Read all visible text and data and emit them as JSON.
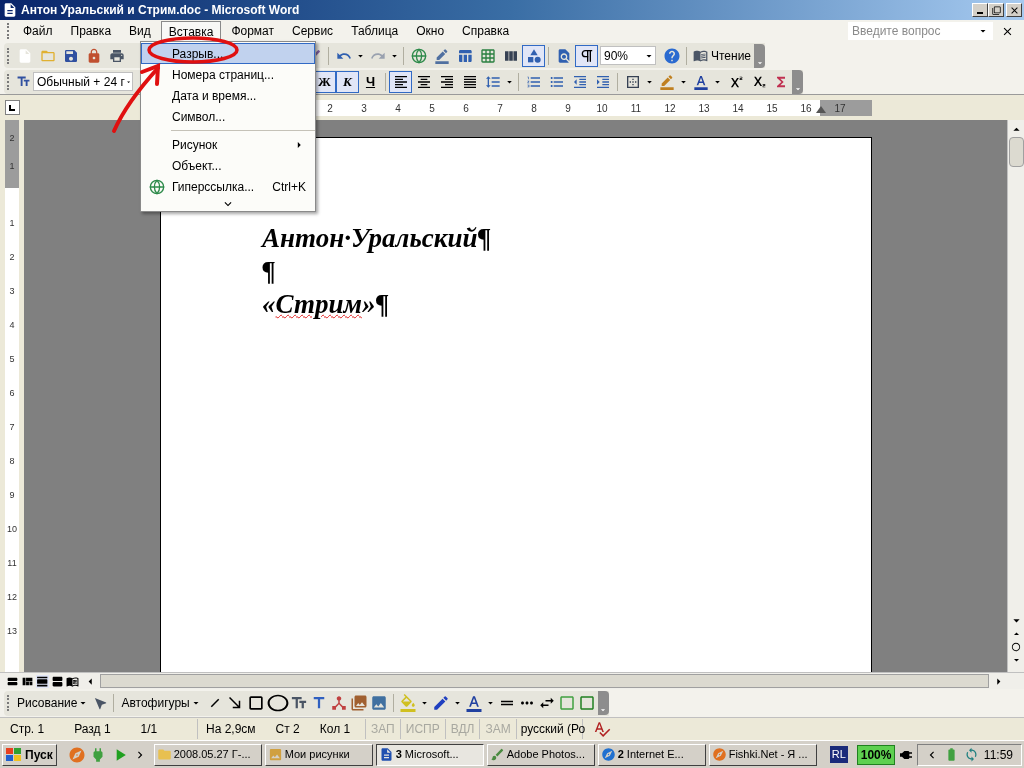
{
  "window": {
    "title": "Антон Уральский и Стрим.doc - Microsoft Word"
  },
  "menu_bar": {
    "items": [
      {
        "label": "Файл",
        "selected": false
      },
      {
        "label": "Правка",
        "selected": false
      },
      {
        "label": "Вид",
        "selected": false
      },
      {
        "label": "Вставка",
        "selected": true
      },
      {
        "label": "Формат",
        "selected": false
      },
      {
        "label": "Сервис",
        "selected": false
      },
      {
        "label": "Таблица",
        "selected": false
      },
      {
        "label": "Окно",
        "selected": false
      },
      {
        "label": "Справка",
        "selected": false
      }
    ],
    "help_placeholder": "Введите вопрос"
  },
  "insert_menu": {
    "items": [
      {
        "kind": "item",
        "label": "Разрыв...",
        "selected": true
      },
      {
        "kind": "item",
        "label": "Номера страниц...",
        "selected": false
      },
      {
        "kind": "item",
        "label": "Дата и время...",
        "selected": false
      },
      {
        "kind": "item",
        "label": "Символ...",
        "selected": false
      },
      {
        "kind": "separator"
      },
      {
        "kind": "submenu",
        "label": "Рисунок",
        "selected": false
      },
      {
        "kind": "item",
        "label": "Объект...",
        "selected": false
      },
      {
        "kind": "link",
        "label": "Гиперссылка...",
        "shortcut": "Ctrl+K",
        "selected": false
      }
    ]
  },
  "standard_toolbar": {
    "left": [
      {
        "kind": "new",
        "pressed": false
      },
      {
        "kind": "open",
        "pressed": false
      },
      {
        "kind": "save",
        "pressed": false
      },
      {
        "kind": "permission",
        "pressed": false
      },
      {
        "kind": "print",
        "pressed": false
      }
    ],
    "right": [
      {
        "kind": "painter",
        "pressed": false
      },
      {
        "kind": "separator"
      },
      {
        "kind": "undo",
        "pressed": false
      },
      {
        "kind": "redo",
        "pressed": false
      },
      {
        "kind": "separator"
      },
      {
        "kind": "hyperlink",
        "pressed": false
      },
      {
        "kind": "tables",
        "pressed": false
      },
      {
        "kind": "table",
        "pressed": false
      },
      {
        "kind": "excel",
        "pressed": false
      },
      {
        "kind": "columns",
        "pressed": false
      },
      {
        "kind": "drawing",
        "pressed": true
      },
      {
        "kind": "separator"
      },
      {
        "kind": "docmap",
        "pressed": false
      },
      {
        "kind": "pilcrow",
        "pressed": true
      }
    ],
    "zoom": "90%",
    "reading": "Чтение"
  },
  "formatting_toolbar": {
    "style": "Обычный + 24 г",
    "format_buttons": [
      {
        "kind": "bold",
        "label": "Ж",
        "pressed": true
      },
      {
        "kind": "italic",
        "label": "К",
        "pressed": true
      },
      {
        "kind": "underline",
        "label": "Ч",
        "pressed": false
      }
    ],
    "buttons": [
      {
        "kind": "separator"
      },
      {
        "kind": "align_left",
        "pressed": true
      },
      {
        "kind": "align_center",
        "pressed": false
      },
      {
        "kind": "align_right",
        "pressed": false
      },
      {
        "kind": "justify",
        "pressed": false
      },
      {
        "kind": "line_spacing",
        "pressed": false
      },
      {
        "kind": "separator"
      },
      {
        "kind": "numbering",
        "pressed": false
      },
      {
        "kind": "bullets",
        "pressed": false
      },
      {
        "kind": "outdent",
        "pressed": false
      },
      {
        "kind": "indent",
        "pressed": false
      },
      {
        "kind": "separator"
      },
      {
        "kind": "border",
        "pressed": false
      },
      {
        "kind": "highlight",
        "pressed": false
      },
      {
        "kind": "font_color",
        "pressed": false
      },
      {
        "kind": "superscript",
        "pressed": false
      },
      {
        "kind": "subscript",
        "pressed": false
      },
      {
        "kind": "equation",
        "pressed": false
      }
    ]
  },
  "ruler": {
    "numbers": [
      "2",
      "3",
      "4",
      "5",
      "6",
      "7",
      "8",
      "9",
      "10",
      "11",
      "12",
      "13",
      "14",
      "15",
      "16",
      "17"
    ]
  },
  "vertical_ruler": {
    "numbers": [
      "2",
      "1",
      "1",
      "2",
      "3",
      "4",
      "5",
      "6",
      "7",
      "8",
      "9",
      "10",
      "11",
      "12",
      "13"
    ]
  },
  "document": {
    "lines": [
      {
        "segments": [
          {
            "text": "Антон·Уральский¶",
            "misspelled": false
          }
        ]
      },
      {
        "segments": [
          {
            "text": "¶",
            "misspelled": false
          }
        ]
      },
      {
        "segments": [
          {
            "text": "«",
            "misspelled": false
          },
          {
            "text": "Стрим",
            "misspelled": true
          },
          {
            "text": "»¶",
            "misspelled": false
          }
        ]
      }
    ]
  },
  "drawing_toolbar": {
    "drawing_menu": "Рисование",
    "autoshapes": "Автофигуры"
  },
  "status_bar": {
    "position": [
      "Стр. 1",
      "Разд 1",
      "1/1"
    ],
    "cursor": [
      "На 2,9см",
      "Ст 2",
      "Кол 1"
    ],
    "modes": [
      {
        "label": "ЗАП",
        "disabled": true
      },
      {
        "label": "ИСПР",
        "disabled": true
      },
      {
        "label": "ВДЛ",
        "disabled": true
      },
      {
        "label": "ЗАМ",
        "disabled": true
      }
    ],
    "language": "русский (Ро"
  },
  "taskbar": {
    "start": "Пуск",
    "tasks": [
      {
        "kind": "folder",
        "label": "2008.05.27 Г-...",
        "selected": false
      },
      {
        "kind": "pictures",
        "label": "Мои рисунки",
        "selected": false
      },
      {
        "kind": "word",
        "label": "**3** Microsoft...",
        "selected": true
      },
      {
        "kind": "photoshop",
        "label": "Adobe Photos...",
        "selected": false
      },
      {
        "kind": "ie",
        "label": "**2** Internet E...",
        "selected": false
      },
      {
        "kind": "firefox",
        "label": "Fishki.Net - Я ...",
        "selected": false
      }
    ],
    "layout": "RL",
    "battery": "100%",
    "clock": "11:59"
  }
}
